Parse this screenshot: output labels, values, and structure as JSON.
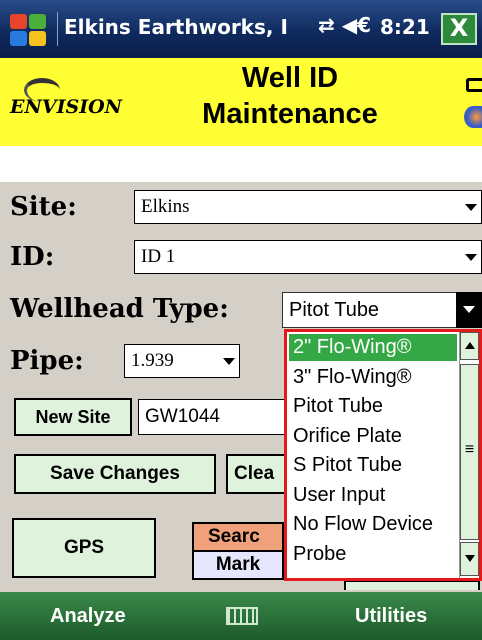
{
  "titlebar": {
    "app_title": "Elkins Earthworks, I",
    "status_icons": "⇄ ◀€",
    "clock": "8:21",
    "close_label": "X"
  },
  "header": {
    "logo_text": "ENVISION",
    "title_line1": "Well ID",
    "title_line2": "Maintenance"
  },
  "form": {
    "site_label": "Site:",
    "site_value": "Elkins",
    "id_label": "ID:",
    "id_value": "ID 1",
    "wellhead_label": "Wellhead Type:",
    "wellhead_value": "Pitot Tube",
    "pipe_label": "Pipe:",
    "pipe_value": "1.939",
    "new_site_label": "New Site",
    "new_site_value": "GW1044",
    "save_label": "Save Changes",
    "clear_label": "Clea",
    "gps_label": "GPS",
    "search_label": "Searc",
    "mark_label": "Mark"
  },
  "dropdown": {
    "options": [
      "2\" Flo-Wing®",
      "3\" Flo-Wing®",
      "Pitot Tube",
      "Orifice Plate",
      "S Pitot Tube",
      "User Input",
      "No Flow Device",
      "Probe"
    ],
    "selected_index": 0,
    "thumb_glyph": "≡"
  },
  "menubar": {
    "left": "Analyze",
    "right": "Utilities"
  }
}
